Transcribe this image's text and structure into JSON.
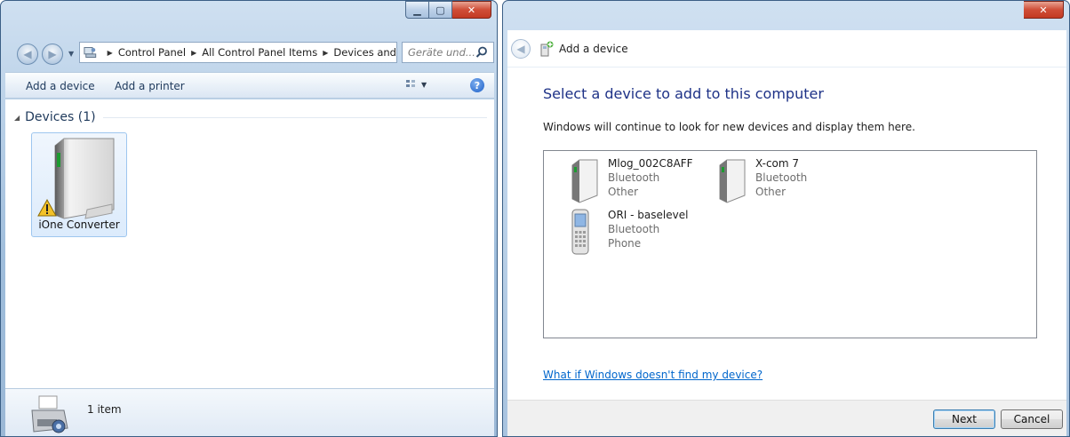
{
  "left_window": {
    "address": {
      "crumbs": [
        "Control Panel",
        "All Control Panel Items",
        "Devices and"
      ]
    },
    "search": {
      "placeholder": "Geräte und..."
    },
    "toolbar": {
      "add_device": "Add a device",
      "add_printer": "Add a printer"
    },
    "group": {
      "label": "Devices (1)"
    },
    "devices": [
      {
        "name": "iOne Converter",
        "status": "warning"
      }
    ],
    "details": {
      "count": "1 item"
    }
  },
  "right_window": {
    "title": "Add a device",
    "heading": "Select a device to add to this computer",
    "description": "Windows will continue to look for new devices and display them here.",
    "devices": [
      {
        "name": "Mlog_002C8AFF",
        "type": "Bluetooth",
        "category": "Other",
        "icon": "bluetooth-device-icon"
      },
      {
        "name": "X-com 7",
        "type": "Bluetooth",
        "category": "Other",
        "icon": "bluetooth-device-icon"
      },
      {
        "name": "ORI - baselevel",
        "type": "Bluetooth",
        "category": "Phone",
        "icon": "phone-icon"
      }
    ],
    "help_link": "What if Windows doesn't find my device?",
    "buttons": {
      "next": "Next",
      "cancel": "Cancel"
    }
  },
  "colors": {
    "heading_blue": "#1e3287",
    "link_blue": "#0066cc",
    "close_red": "#c33a23",
    "selection_blue": "#dcebfc"
  }
}
